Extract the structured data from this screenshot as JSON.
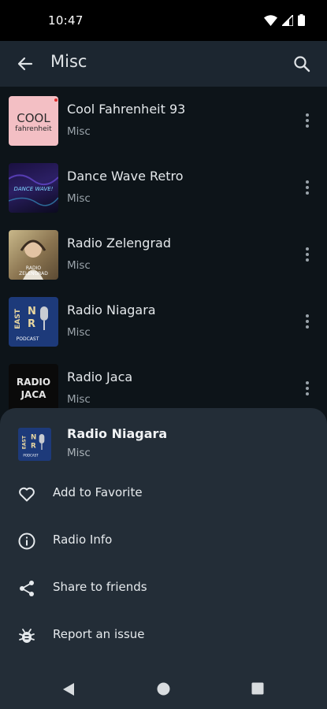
{
  "status": {
    "time": "10:47"
  },
  "header": {
    "title": "Misc"
  },
  "stations": [
    {
      "name": "Cool Fahrenheit 93",
      "category": "Misc",
      "logo_text_1": "COOL",
      "logo_text_2": "fahrenheit"
    },
    {
      "name": "Dance Wave Retro",
      "category": "Misc",
      "logo_text_1": "DANCE WAVE!"
    },
    {
      "name": "Radio Zelengrad",
      "category": "Misc",
      "logo_text_1": "RADIO",
      "logo_text_2": "ZELENGRAD"
    },
    {
      "name": "Radio Niagara",
      "category": "Misc",
      "logo_text_1": "EAST",
      "logo_text_2": "PODCAST"
    },
    {
      "name": "Radio Jaca",
      "category": "Misc",
      "logo_text_1": "RADIO",
      "logo_text_2": "JACA"
    }
  ],
  "sheet": {
    "station_name": "Radio Niagara",
    "station_category": "Misc",
    "actions": [
      {
        "label": "Add to Favorite",
        "icon": "heart-icon"
      },
      {
        "label": "Radio Info",
        "icon": "info-icon"
      },
      {
        "label": "Share to friends",
        "icon": "share-icon"
      },
      {
        "label": "Report an issue",
        "icon": "bug-icon"
      }
    ]
  }
}
